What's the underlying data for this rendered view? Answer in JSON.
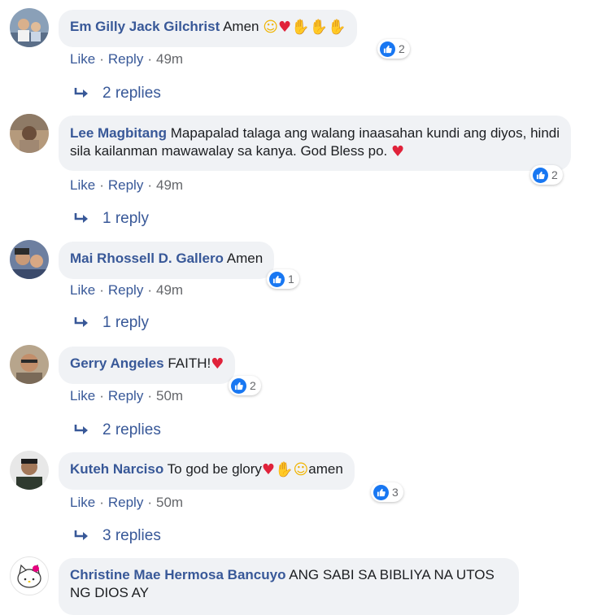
{
  "comments": [
    {
      "author": "Em Gilly Jack Gilchrist",
      "text": "Amen",
      "emojis": [
        "smiling-face-with-halo",
        "heart",
        "folded-hands",
        "folded-hands",
        "folded-hands"
      ],
      "reaction_count": "2",
      "like": "Like",
      "reply": "Reply",
      "time": "49m",
      "replies": "2 replies"
    },
    {
      "author": "Lee Magbitang",
      "text": "Mapapalad talaga ang walang inaasahan kundi ang diyos, hindi sila kailanman mawawalay sa kanya. God Bless po.",
      "emojis": [
        "heart"
      ],
      "reaction_count": "2",
      "like": "Like",
      "reply": "Reply",
      "time": "49m",
      "replies": "1 reply"
    },
    {
      "author": "Mai Rhossell D. Gallero",
      "text": "Amen",
      "reaction_count": "1",
      "like": "Like",
      "reply": "Reply",
      "time": "49m",
      "replies": "1 reply"
    },
    {
      "author": "Gerry Angeles",
      "text": "FAITH!",
      "emojis": [
        "heart"
      ],
      "reaction_count": "2",
      "like": "Like",
      "reply": "Reply",
      "time": "50m",
      "replies": "2 replies"
    },
    {
      "author": "Kuteh Narciso",
      "text": "To god be glory",
      "text_after": "amen",
      "emojis": [
        "heart",
        "folded-hands",
        "smiling-face-with-halo"
      ],
      "reaction_count": "3",
      "like": "Like",
      "reply": "Reply",
      "time": "50m",
      "replies": "3 replies"
    },
    {
      "author": "Christine Mae Hermosa Bancuyo",
      "text": "ANG SABI SA BIBLIYA NA UTOS NG DIOS AY"
    }
  ],
  "dot": "·",
  "colors": {
    "link": "#385898",
    "bubble": "#f0f2f5",
    "like_blue": "#1877f2",
    "meta": "#65676b"
  }
}
